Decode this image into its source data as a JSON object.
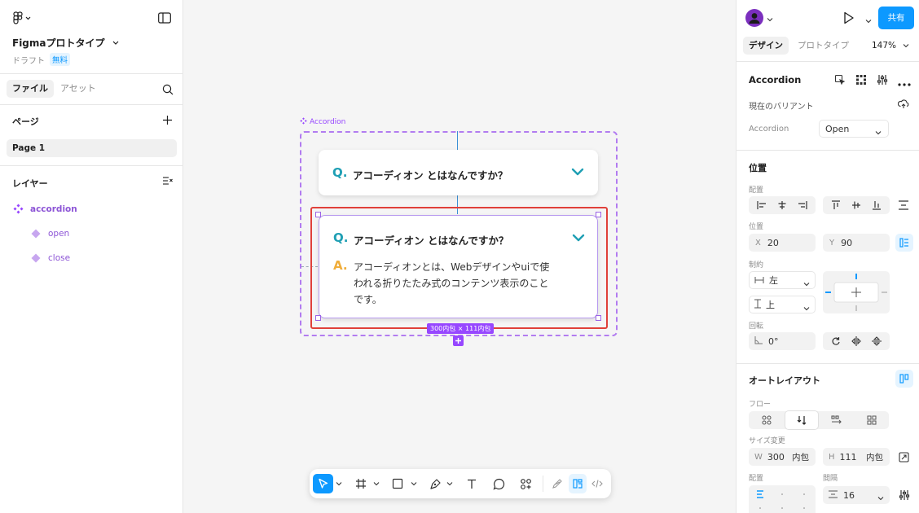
{
  "left": {
    "file_title": "Figmaプロトタイプ",
    "draft_label": "ドラフト",
    "plan_badge": "無料",
    "tabs": [
      "ファイル",
      "アセット"
    ],
    "pages_title": "ページ",
    "pages": [
      "Page 1"
    ],
    "layers_title": "レイヤー",
    "layers": [
      {
        "name": "accordion",
        "icon": "component-set-icon"
      },
      {
        "name": "open",
        "icon": "variant-icon"
      },
      {
        "name": "close",
        "icon": "variant-icon"
      }
    ]
  },
  "canvas": {
    "frame_label": "Accordion",
    "question_letter": "Q.",
    "answer_letter": "A.",
    "question": "アコーディオン とはなんですか？",
    "answer_lines": [
      "アコーディオンとは、Webデザインやuiで使",
      "われる折りたたみ式のコンテンツ表示のこと",
      "です。"
    ],
    "size_badge": "300内包 × 111内包"
  },
  "right": {
    "share_label": "共有",
    "tabs": [
      "デザイン",
      "プロトタイプ"
    ],
    "zoom": "147%",
    "component_name": "Accordion",
    "variant_title": "現在のバリアント",
    "variant_prop": "Accordion",
    "variant_value": "Open",
    "position_title": "位置",
    "align_label": "配置",
    "pos_label": "位置",
    "x_label": "X",
    "x_value": "20",
    "y_label": "Y",
    "y_value": "90",
    "constraint_label": "制約",
    "h_constraint": "左",
    "v_constraint": "上",
    "rotation_label": "回転",
    "rotation_value": "0°",
    "autolayout_title": "オートレイアウト",
    "flow_label": "フロー",
    "resize_label": "サイズ変更",
    "w_label": "W",
    "w_value": "300",
    "w_mode": "内包",
    "h_label": "H",
    "h_value": "111",
    "h_mode": "内包",
    "alignment_label": "配置",
    "gap_label": "間隔",
    "gap_value": "16"
  },
  "colors": {
    "accent": "#0d99ff",
    "component": "#9747ff",
    "selection_red": "#e0413a",
    "question_teal": "#1f9fb4",
    "answer_orange": "#f0ad3a"
  }
}
